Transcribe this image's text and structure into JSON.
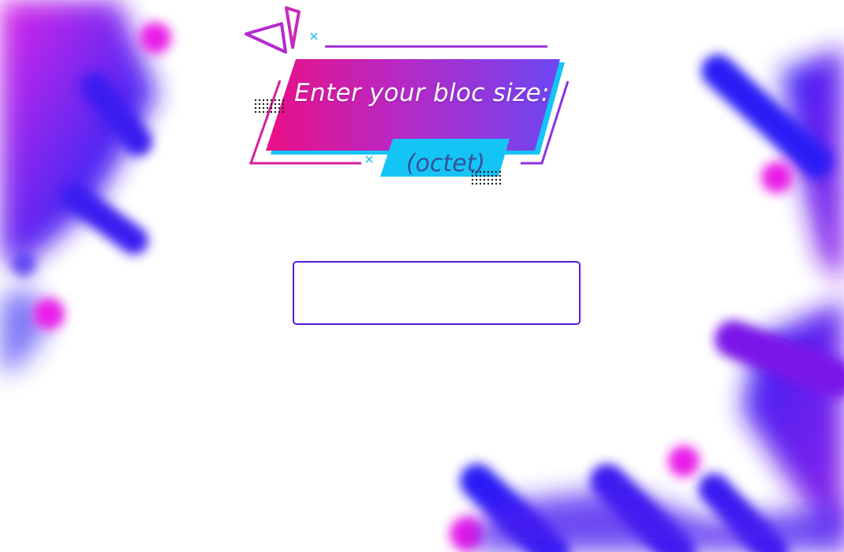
{
  "prompt": {
    "title": "Enter your bloc size:",
    "unit": "(octet)"
  },
  "input": {
    "value": "",
    "placeholder": ""
  },
  "colors": {
    "magenta": "#e0168c",
    "violet": "#7a3cf0",
    "blue": "#2b1cf5",
    "cyan": "#14c4f5",
    "input_border": "#5a1bd6"
  }
}
